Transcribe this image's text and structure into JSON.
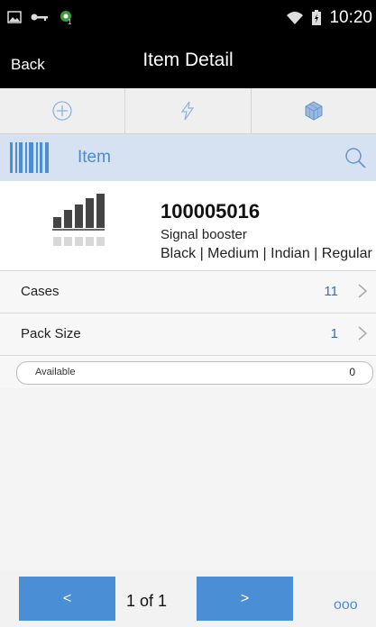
{
  "status_bar": {
    "time": "10:20"
  },
  "header": {
    "back_label": "Back",
    "title": "Item Detail"
  },
  "actions": [
    {
      "icon": "plus-circle-icon"
    },
    {
      "icon": "lightning-icon"
    },
    {
      "icon": "cube-icon"
    }
  ],
  "scan": {
    "label": "Item"
  },
  "item": {
    "number": "100005016",
    "description": "Signal booster",
    "attributes": "Black | Medium | Indian | Regular"
  },
  "rows": [
    {
      "label": "Cases",
      "value": "11"
    },
    {
      "label": "Pack Size",
      "value": "1"
    }
  ],
  "available": {
    "label": "Available",
    "value": "0"
  },
  "footer": {
    "prev_label": "<",
    "next_label": ">",
    "pager": "1 of 1",
    "more_label": "ooo"
  },
  "colors": {
    "accent": "#4a8fd6",
    "scan_bg": "#d6e2f2",
    "header_bg": "#000000"
  }
}
